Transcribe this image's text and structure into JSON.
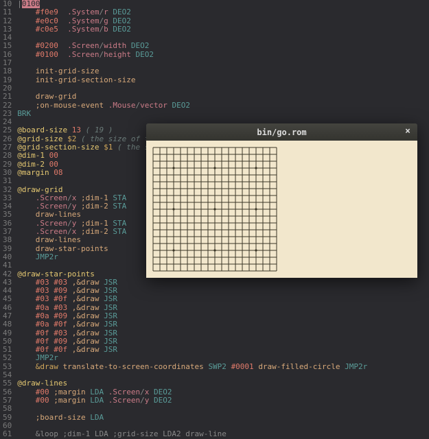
{
  "editor": {
    "first_line_number": 10,
    "lines": [
      [
        [
          "t-sl",
          "|"
        ],
        [
          "cursor",
          "0100"
        ]
      ],
      [
        [
          "t-plain",
          "    "
        ],
        [
          "t-hex",
          "#f0e9"
        ],
        [
          "t-plain",
          "  "
        ],
        [
          "t-dev",
          ".System"
        ],
        [
          "t-sl",
          "/"
        ],
        [
          "t-dev",
          "r"
        ],
        [
          "t-plain",
          " "
        ],
        [
          "t-op",
          "DEO2"
        ]
      ],
      [
        [
          "t-plain",
          "    "
        ],
        [
          "t-hex",
          "#e0c0"
        ],
        [
          "t-plain",
          "  "
        ],
        [
          "t-dev",
          ".System"
        ],
        [
          "t-sl",
          "/"
        ],
        [
          "t-dev",
          "g"
        ],
        [
          "t-plain",
          " "
        ],
        [
          "t-op",
          "DEO2"
        ]
      ],
      [
        [
          "t-plain",
          "    "
        ],
        [
          "t-hex",
          "#c0e5"
        ],
        [
          "t-plain",
          "  "
        ],
        [
          "t-dev",
          ".System"
        ],
        [
          "t-sl",
          "/"
        ],
        [
          "t-dev",
          "b"
        ],
        [
          "t-plain",
          " "
        ],
        [
          "t-op",
          "DEO2"
        ]
      ],
      [],
      [
        [
          "t-plain",
          "    "
        ],
        [
          "t-hex",
          "#0200"
        ],
        [
          "t-plain",
          "  "
        ],
        [
          "t-dev",
          ".Screen"
        ],
        [
          "t-sl",
          "/"
        ],
        [
          "t-dev",
          "width"
        ],
        [
          "t-plain",
          " "
        ],
        [
          "t-op",
          "DEO2"
        ]
      ],
      [
        [
          "t-plain",
          "    "
        ],
        [
          "t-hex",
          "#0100"
        ],
        [
          "t-plain",
          "  "
        ],
        [
          "t-dev",
          ".Screen"
        ],
        [
          "t-sl",
          "/"
        ],
        [
          "t-dev",
          "height"
        ],
        [
          "t-plain",
          " "
        ],
        [
          "t-op",
          "DEO2"
        ]
      ],
      [],
      [
        [
          "t-plain",
          "    "
        ],
        [
          "t-peach",
          "init-grid-size"
        ]
      ],
      [
        [
          "t-plain",
          "    "
        ],
        [
          "t-peach",
          "init-grid-section-size"
        ]
      ],
      [],
      [
        [
          "t-plain",
          "    "
        ],
        [
          "t-peach",
          "draw-grid"
        ]
      ],
      [
        [
          "t-plain",
          "    "
        ],
        [
          "t-peach",
          ";on-mouse-event"
        ],
        [
          "t-plain",
          " "
        ],
        [
          "t-dev",
          ".Mouse"
        ],
        [
          "t-sl",
          "/"
        ],
        [
          "t-dev",
          "vector"
        ],
        [
          "t-plain",
          " "
        ],
        [
          "t-op",
          "DEO2"
        ]
      ],
      [
        [
          "t-op",
          "BRK"
        ]
      ],
      [],
      [
        [
          "t-label",
          "@board-size"
        ],
        [
          "t-plain",
          " "
        ],
        [
          "t-hex",
          "13"
        ],
        [
          "t-plain",
          " "
        ],
        [
          "t-comment",
          "( 19 )"
        ]
      ],
      [
        [
          "t-label",
          "@grid-size"
        ],
        [
          "t-plain",
          " "
        ],
        [
          "t-star",
          "$2"
        ],
        [
          "t-plain",
          " "
        ],
        [
          "t-comment",
          "( the size of the grid )"
        ]
      ],
      [
        [
          "t-label",
          "@grid-section-size"
        ],
        [
          "t-plain",
          " "
        ],
        [
          "t-star",
          "$1"
        ],
        [
          "t-plain",
          " "
        ],
        [
          "t-comment",
          "( the size of each section )"
        ]
      ],
      [
        [
          "t-label",
          "@dim-1"
        ],
        [
          "t-plain",
          " "
        ],
        [
          "t-hex",
          "00"
        ]
      ],
      [
        [
          "t-label",
          "@dim-2"
        ],
        [
          "t-plain",
          " "
        ],
        [
          "t-hex",
          "00"
        ]
      ],
      [
        [
          "t-label",
          "@margin"
        ],
        [
          "t-plain",
          " "
        ],
        [
          "t-hex",
          "08"
        ]
      ],
      [],
      [
        [
          "t-label",
          "@draw-grid"
        ]
      ],
      [
        [
          "t-plain",
          "    "
        ],
        [
          "t-dev",
          ".Screen"
        ],
        [
          "t-sl",
          "/"
        ],
        [
          "t-dev",
          "x"
        ],
        [
          "t-plain",
          " "
        ],
        [
          "t-peach",
          ";dim-1"
        ],
        [
          "t-plain",
          " "
        ],
        [
          "t-op",
          "STA"
        ]
      ],
      [
        [
          "t-plain",
          "    "
        ],
        [
          "t-dev",
          ".Screen"
        ],
        [
          "t-sl",
          "/"
        ],
        [
          "t-dev",
          "y"
        ],
        [
          "t-plain",
          " "
        ],
        [
          "t-peach",
          ";dim-2"
        ],
        [
          "t-plain",
          " "
        ],
        [
          "t-op",
          "STA"
        ]
      ],
      [
        [
          "t-plain",
          "    "
        ],
        [
          "t-peach",
          "draw-lines"
        ]
      ],
      [
        [
          "t-plain",
          "    "
        ],
        [
          "t-dev",
          ".Screen"
        ],
        [
          "t-sl",
          "/"
        ],
        [
          "t-dev",
          "y"
        ],
        [
          "t-plain",
          " "
        ],
        [
          "t-peach",
          ";dim-1"
        ],
        [
          "t-plain",
          " "
        ],
        [
          "t-op",
          "STA"
        ]
      ],
      [
        [
          "t-plain",
          "    "
        ],
        [
          "t-dev",
          ".Screen"
        ],
        [
          "t-sl",
          "/"
        ],
        [
          "t-dev",
          "x"
        ],
        [
          "t-plain",
          " "
        ],
        [
          "t-peach",
          ";dim-2"
        ],
        [
          "t-plain",
          " "
        ],
        [
          "t-op",
          "STA"
        ]
      ],
      [
        [
          "t-plain",
          "    "
        ],
        [
          "t-peach",
          "draw-lines"
        ]
      ],
      [
        [
          "t-plain",
          "    "
        ],
        [
          "t-peach",
          "draw-star-points"
        ]
      ],
      [
        [
          "t-plain",
          "    "
        ],
        [
          "t-op",
          "JMP2r"
        ]
      ],
      [],
      [
        [
          "t-label",
          "@draw-star-points"
        ]
      ],
      [
        [
          "t-plain",
          "    "
        ],
        [
          "t-hex",
          "#03"
        ],
        [
          "t-plain",
          " "
        ],
        [
          "t-hex",
          "#03"
        ],
        [
          "t-plain",
          " "
        ],
        [
          "t-peach",
          ",&draw"
        ],
        [
          "t-plain",
          " "
        ],
        [
          "t-op",
          "JSR"
        ]
      ],
      [
        [
          "t-plain",
          "    "
        ],
        [
          "t-hex",
          "#03"
        ],
        [
          "t-plain",
          " "
        ],
        [
          "t-hex",
          "#09"
        ],
        [
          "t-plain",
          " "
        ],
        [
          "t-peach",
          ",&draw"
        ],
        [
          "t-plain",
          " "
        ],
        [
          "t-op",
          "JSR"
        ]
      ],
      [
        [
          "t-plain",
          "    "
        ],
        [
          "t-hex",
          "#03"
        ],
        [
          "t-plain",
          " "
        ],
        [
          "t-hex",
          "#0f"
        ],
        [
          "t-plain",
          " "
        ],
        [
          "t-peach",
          ",&draw"
        ],
        [
          "t-plain",
          " "
        ],
        [
          "t-op",
          "JSR"
        ]
      ],
      [
        [
          "t-plain",
          "    "
        ],
        [
          "t-hex",
          "#0a"
        ],
        [
          "t-plain",
          " "
        ],
        [
          "t-hex",
          "#03"
        ],
        [
          "t-plain",
          " "
        ],
        [
          "t-peach",
          ",&draw"
        ],
        [
          "t-plain",
          " "
        ],
        [
          "t-op",
          "JSR"
        ]
      ],
      [
        [
          "t-plain",
          "    "
        ],
        [
          "t-hex",
          "#0a"
        ],
        [
          "t-plain",
          " "
        ],
        [
          "t-hex",
          "#09"
        ],
        [
          "t-plain",
          " "
        ],
        [
          "t-peach",
          ",&draw"
        ],
        [
          "t-plain",
          " "
        ],
        [
          "t-op",
          "JSR"
        ]
      ],
      [
        [
          "t-plain",
          "    "
        ],
        [
          "t-hex",
          "#0a"
        ],
        [
          "t-plain",
          " "
        ],
        [
          "t-hex",
          "#0f"
        ],
        [
          "t-plain",
          " "
        ],
        [
          "t-peach",
          ",&draw"
        ],
        [
          "t-plain",
          " "
        ],
        [
          "t-op",
          "JSR"
        ]
      ],
      [
        [
          "t-plain",
          "    "
        ],
        [
          "t-hex",
          "#0f"
        ],
        [
          "t-plain",
          " "
        ],
        [
          "t-hex",
          "#03"
        ],
        [
          "t-plain",
          " "
        ],
        [
          "t-peach",
          ",&draw"
        ],
        [
          "t-plain",
          " "
        ],
        [
          "t-op",
          "JSR"
        ]
      ],
      [
        [
          "t-plain",
          "    "
        ],
        [
          "t-hex",
          "#0f"
        ],
        [
          "t-plain",
          " "
        ],
        [
          "t-hex",
          "#09"
        ],
        [
          "t-plain",
          " "
        ],
        [
          "t-peach",
          ",&draw"
        ],
        [
          "t-plain",
          " "
        ],
        [
          "t-op",
          "JSR"
        ]
      ],
      [
        [
          "t-plain",
          "    "
        ],
        [
          "t-hex",
          "#0f"
        ],
        [
          "t-plain",
          " "
        ],
        [
          "t-hex",
          "#0f"
        ],
        [
          "t-plain",
          " "
        ],
        [
          "t-peach",
          ",&draw"
        ],
        [
          "t-plain",
          " "
        ],
        [
          "t-op",
          "JSR"
        ]
      ],
      [
        [
          "t-plain",
          "    "
        ],
        [
          "t-op",
          "JMP2r"
        ]
      ],
      [
        [
          "t-plain",
          "    "
        ],
        [
          "t-star",
          "&draw"
        ],
        [
          "t-plain",
          " "
        ],
        [
          "t-peach",
          "translate-to-screen-coordinates"
        ],
        [
          "t-plain",
          " "
        ],
        [
          "t-op",
          "SWP2"
        ],
        [
          "t-plain",
          " "
        ],
        [
          "t-hex",
          "#0001"
        ],
        [
          "t-plain",
          " "
        ],
        [
          "t-peach",
          "draw-filled-circle"
        ],
        [
          "t-plain",
          " "
        ],
        [
          "t-op",
          "JMP2r"
        ]
      ],
      [],
      [
        [
          "t-label",
          "@draw-lines"
        ]
      ],
      [
        [
          "t-plain",
          "    "
        ],
        [
          "t-hex",
          "#00"
        ],
        [
          "t-plain",
          " "
        ],
        [
          "t-peach",
          ";margin"
        ],
        [
          "t-plain",
          " "
        ],
        [
          "t-op",
          "LDA"
        ],
        [
          "t-plain",
          " "
        ],
        [
          "t-dev",
          ".Screen"
        ],
        [
          "t-sl",
          "/"
        ],
        [
          "t-dev",
          "x"
        ],
        [
          "t-plain",
          " "
        ],
        [
          "t-op",
          "DEO2"
        ]
      ],
      [
        [
          "t-plain",
          "    "
        ],
        [
          "t-hex",
          "#00"
        ],
        [
          "t-plain",
          " "
        ],
        [
          "t-peach",
          ";margin"
        ],
        [
          "t-plain",
          " "
        ],
        [
          "t-op",
          "LDA"
        ],
        [
          "t-plain",
          " "
        ],
        [
          "t-dev",
          ".Screen"
        ],
        [
          "t-sl",
          "/"
        ],
        [
          "t-dev",
          "y"
        ],
        [
          "t-plain",
          " "
        ],
        [
          "t-op",
          "DEO2"
        ]
      ],
      [],
      [
        [
          "t-plain",
          "    "
        ],
        [
          "t-peach",
          ";board-size"
        ],
        [
          "t-plain",
          " "
        ],
        [
          "t-op",
          "LDA"
        ]
      ],
      [],
      [
        [
          "t-dim",
          "    &loop ;dim-1 LDA ;grid-size LDA2 draw-line"
        ]
      ]
    ]
  },
  "window": {
    "title": "bin/go.rom",
    "close": "×",
    "board": {
      "grid_size": 19,
      "origin": 10,
      "step": 10,
      "star_points": [
        [
          3,
          3
        ],
        [
          3,
          9
        ],
        [
          3,
          15
        ],
        [
          9,
          3
        ],
        [
          9,
          9
        ],
        [
          9,
          15
        ],
        [
          15,
          3
        ],
        [
          15,
          9
        ],
        [
          15,
          15
        ]
      ]
    }
  }
}
